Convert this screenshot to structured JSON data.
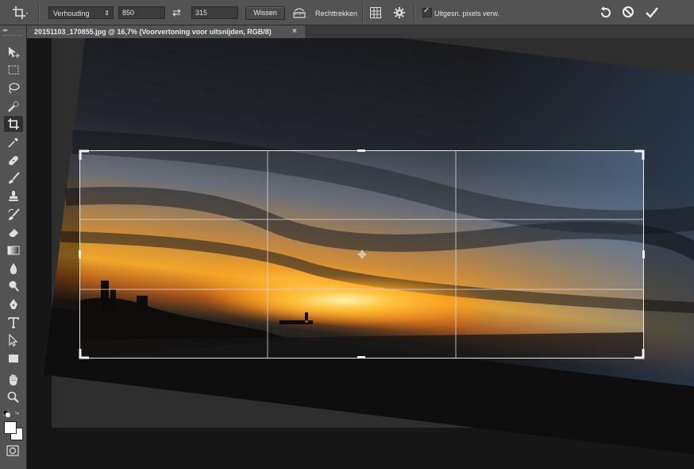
{
  "options_bar": {
    "ratio_label": "Verhouding",
    "width_value": "850",
    "height_value": "315",
    "clear_label": "Wissen",
    "straighten_label": "Rechttrekken",
    "delete_pixels_label": "Uitgesn. pixels verw.",
    "delete_pixels_checked": true
  },
  "document": {
    "tab_title": "20151103_170855.jpg @ 16,7% (Voorvertoning voor uitsnijden, RGB/8)",
    "close_glyph": "×"
  },
  "toolbox": {
    "active_tool": "crop",
    "tools": [
      "move",
      "marquee",
      "lasso",
      "quick-selection",
      "crop",
      "eyedropper",
      "healing-brush",
      "brush",
      "clone-stamp",
      "history-brush",
      "eraser",
      "gradient",
      "blur",
      "dodge",
      "pen",
      "type",
      "path-selection",
      "rectangle",
      "hand",
      "zoom"
    ],
    "foreground_color": "#ffffff",
    "background_color": "#ffffff"
  },
  "colors": {
    "panel": "#535353",
    "workspace": "#282828",
    "canvas_gray": "#555555"
  }
}
